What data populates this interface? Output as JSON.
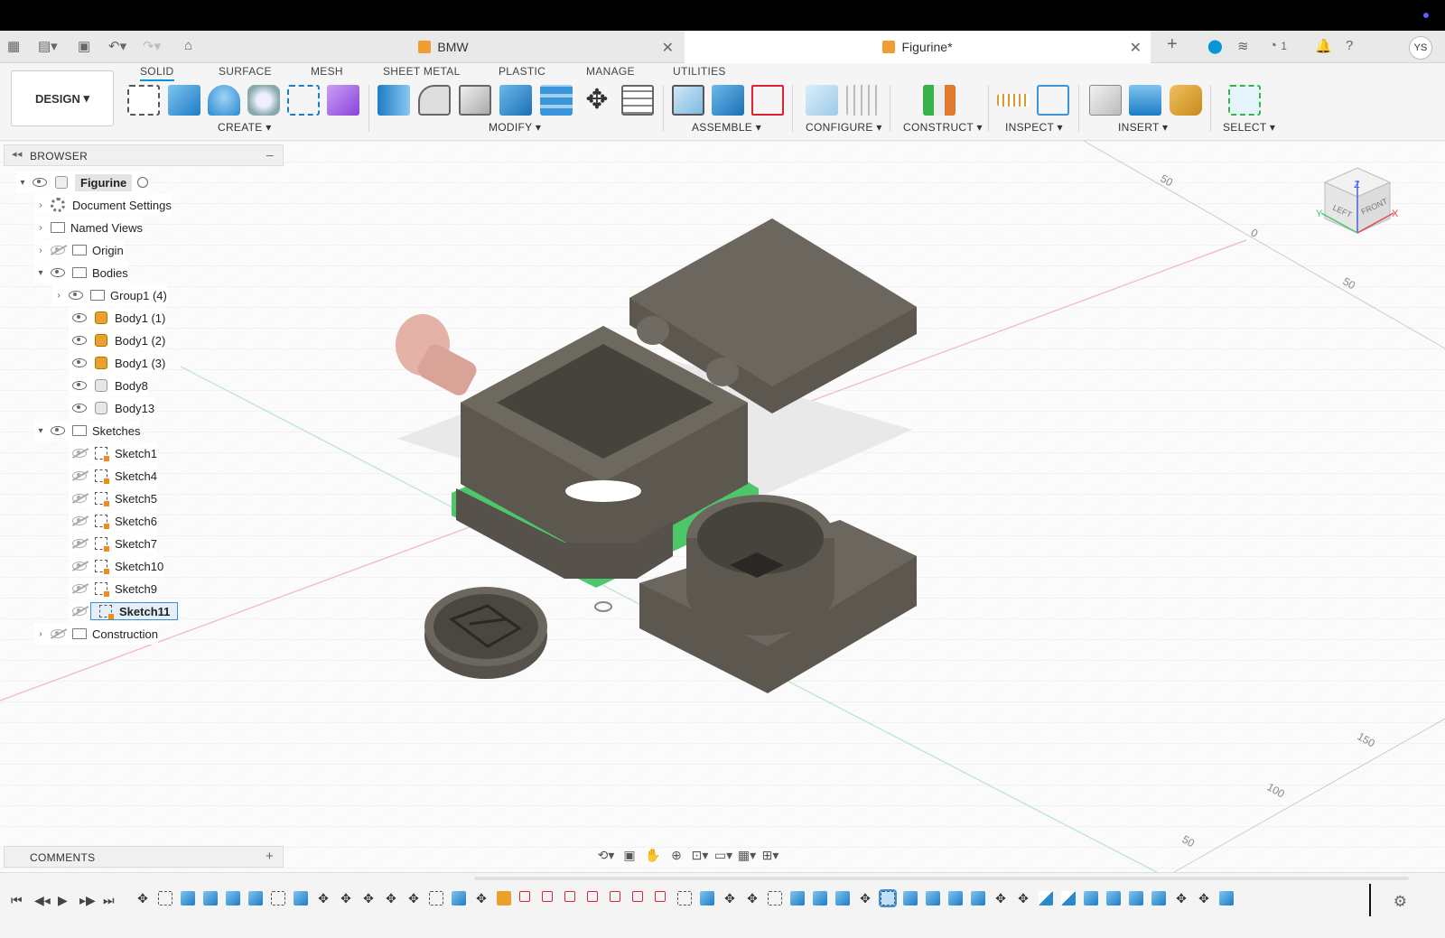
{
  "app": {
    "tabs": [
      {
        "label": "BMW",
        "active": false
      },
      {
        "label": "Figurine*",
        "active": true
      }
    ],
    "notification_count": "1",
    "user_initials": "YS"
  },
  "workspace": {
    "label": "DESIGN"
  },
  "ribbon": {
    "tabs": [
      "SOLID",
      "SURFACE",
      "MESH",
      "SHEET METAL",
      "PLASTIC",
      "MANAGE",
      "UTILITIES"
    ],
    "active_tab": "SOLID",
    "groups": [
      "CREATE",
      "MODIFY",
      "ASSEMBLE",
      "CONFIGURE",
      "CONSTRUCT",
      "INSPECT",
      "INSERT",
      "SELECT"
    ]
  },
  "browser": {
    "title": "BROWSER",
    "root": "Figurine",
    "items": [
      {
        "label": "Document Settings"
      },
      {
        "label": "Named Views"
      },
      {
        "label": "Origin"
      },
      {
        "label": "Bodies"
      },
      {
        "label": "Group1 (4)"
      },
      {
        "label": "Body1 (1)"
      },
      {
        "label": "Body1 (2)"
      },
      {
        "label": "Body1 (3)"
      },
      {
        "label": "Body8"
      },
      {
        "label": "Body13"
      },
      {
        "label": "Sketches"
      },
      {
        "label": "Sketch1"
      },
      {
        "label": "Sketch4"
      },
      {
        "label": "Sketch5"
      },
      {
        "label": "Sketch6"
      },
      {
        "label": "Sketch7"
      },
      {
        "label": "Sketch10"
      },
      {
        "label": "Sketch9"
      },
      {
        "label": "Sketch11"
      },
      {
        "label": "Construction"
      }
    ]
  },
  "comments": {
    "title": "COMMENTS"
  },
  "viewport": {
    "grid_labels": [
      "50",
      "0",
      "50",
      "150",
      "100",
      "50"
    ],
    "viewcube": {
      "top": "Z",
      "left": "LEFT",
      "front": "FRONT",
      "x_axis": "X",
      "y_axis": "Y"
    }
  },
  "colors": {
    "accent": "#0696d7",
    "body_orange": "#e8a12a",
    "model_gray": "#5c5850",
    "selection_green": "#4dc76a"
  }
}
